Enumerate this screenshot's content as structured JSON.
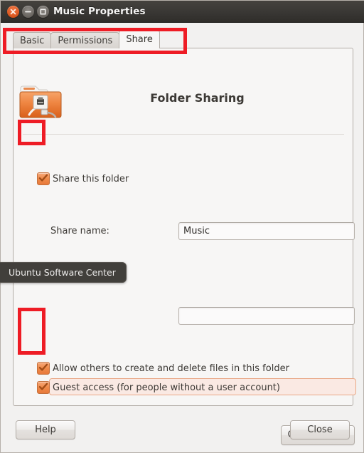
{
  "window": {
    "title": "Music Properties",
    "controls": [
      {
        "name": "close",
        "glyph": "x"
      },
      {
        "name": "minimize",
        "glyph": "-"
      },
      {
        "name": "maximize",
        "glyph": "square"
      }
    ]
  },
  "tabs": [
    {
      "label": "Basic",
      "active": false
    },
    {
      "label": "Permissions",
      "active": false
    },
    {
      "label": "Share",
      "active": true
    }
  ],
  "share_panel": {
    "heading": "Folder Sharing",
    "folder_icon": "shared-folder-icon",
    "share_this_folder": {
      "label": "Share this folder",
      "checked": true
    },
    "share_name": {
      "label": "Share name:",
      "value": "Music",
      "placeholder": ""
    },
    "comment": {
      "value": "",
      "placeholder": ""
    },
    "allow_others": {
      "label": "Allow others to create and delete files in this folder",
      "checked": true
    },
    "guest_access": {
      "label": "Guest access (for people without a user account)",
      "checked": true,
      "highlighted": true
    },
    "create_share_button": "Create Share"
  },
  "footer": {
    "help_button": "Help",
    "close_button": "Close"
  },
  "tooltip": {
    "text": "Ubuntu Software Center"
  },
  "colors": {
    "accent_orange": "#e8793a",
    "annotation_red": "#ee1c25",
    "titlebar_dark": "#3a3835",
    "panel_bg": "#f7f6f5",
    "window_bg": "#f2f1f0",
    "highlight_pink": "#fae9e3"
  }
}
